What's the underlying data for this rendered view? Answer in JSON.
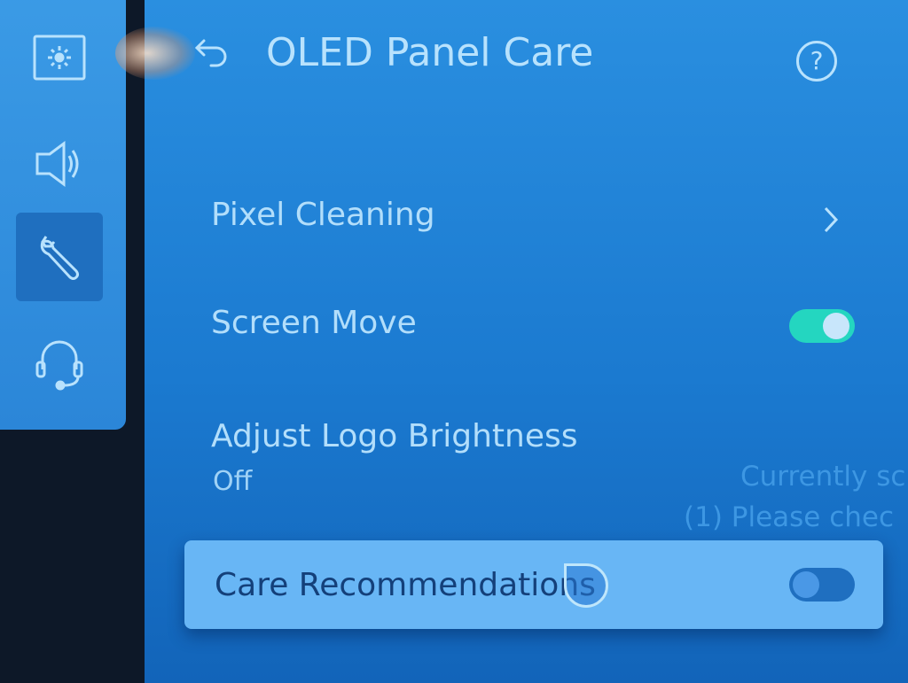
{
  "sidebar": {
    "items": [
      {
        "icon": "picture-brightness-icon",
        "active": false
      },
      {
        "icon": "speaker-icon",
        "active": false
      },
      {
        "icon": "wrench-icon",
        "active": true
      },
      {
        "icon": "headset-support-icon",
        "active": false
      }
    ]
  },
  "header": {
    "title": "OLED Panel Care",
    "back_icon": "back-arrow-icon",
    "help_icon": "help-icon",
    "help_glyph": "?"
  },
  "menu": {
    "pixel_cleaning": {
      "label": "Pixel Cleaning",
      "icon": "chevron-right-icon"
    },
    "screen_move": {
      "label": "Screen Move",
      "toggle": true
    },
    "adjust_logo_brightness": {
      "label": "Adjust Logo Brightness",
      "value": "Off"
    },
    "care_recommendations": {
      "label": "Care Recommendations",
      "toggle": false,
      "focused": true
    }
  },
  "background_text": {
    "line1": "Currently sc",
    "line2": "(1) Please chec"
  },
  "colors": {
    "accent_on": "#24d6c0",
    "focus_bg": "#68b6f5",
    "text": "#b2defb"
  }
}
